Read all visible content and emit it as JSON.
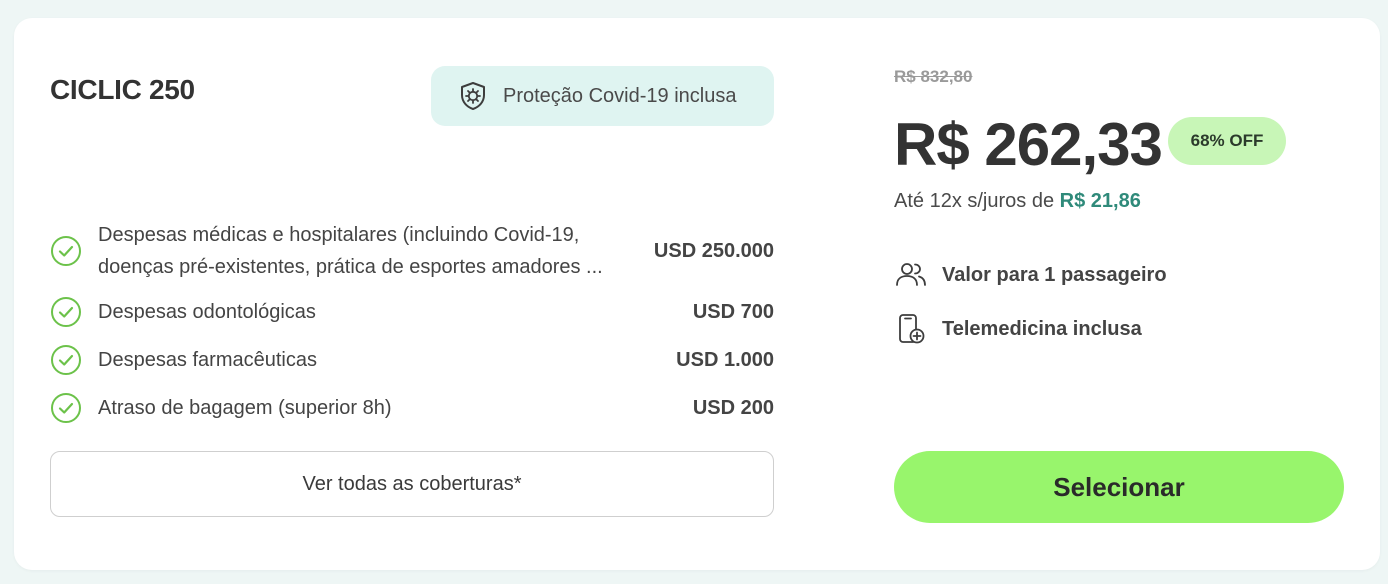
{
  "plan": {
    "name": "CICLIC 250",
    "covid_badge": "Proteção Covid-19 inclusa"
  },
  "coverages": [
    {
      "label_line1": "Despesas médicas e hospitalares (incluindo Covid-19,",
      "label_line2": "doenças pré-existentes, prática de esportes amadores ...",
      "value": "USD 250.000"
    },
    {
      "label": "Despesas odontológicas",
      "value": "USD 700"
    },
    {
      "label": "Despesas farmacêuticas",
      "value": "USD 1.000"
    },
    {
      "label": "Atraso de bagagem (superior 8h)",
      "value": "USD 200"
    }
  ],
  "see_all_label": "Ver todas as coberturas*",
  "pricing": {
    "old_price": "R$ 832,80",
    "price": "R$ 262,33",
    "discount": "68% OFF",
    "installments_prefix": "Até 12x s/juros de ",
    "installments_amount": "R$ 21,86"
  },
  "features": [
    {
      "icon": "users-icon",
      "label": "Valor para 1 passageiro"
    },
    {
      "icon": "telemedicine-icon",
      "label": "Telemedicina inclusa"
    }
  ],
  "select_label": "Selecionar",
  "colors": {
    "check": "#6cc24a",
    "badge_bg": "#dff4f1",
    "discount_bg": "#c8f6b7",
    "installment_amount": "#2f8a7a",
    "select_button": "#98f56c"
  }
}
